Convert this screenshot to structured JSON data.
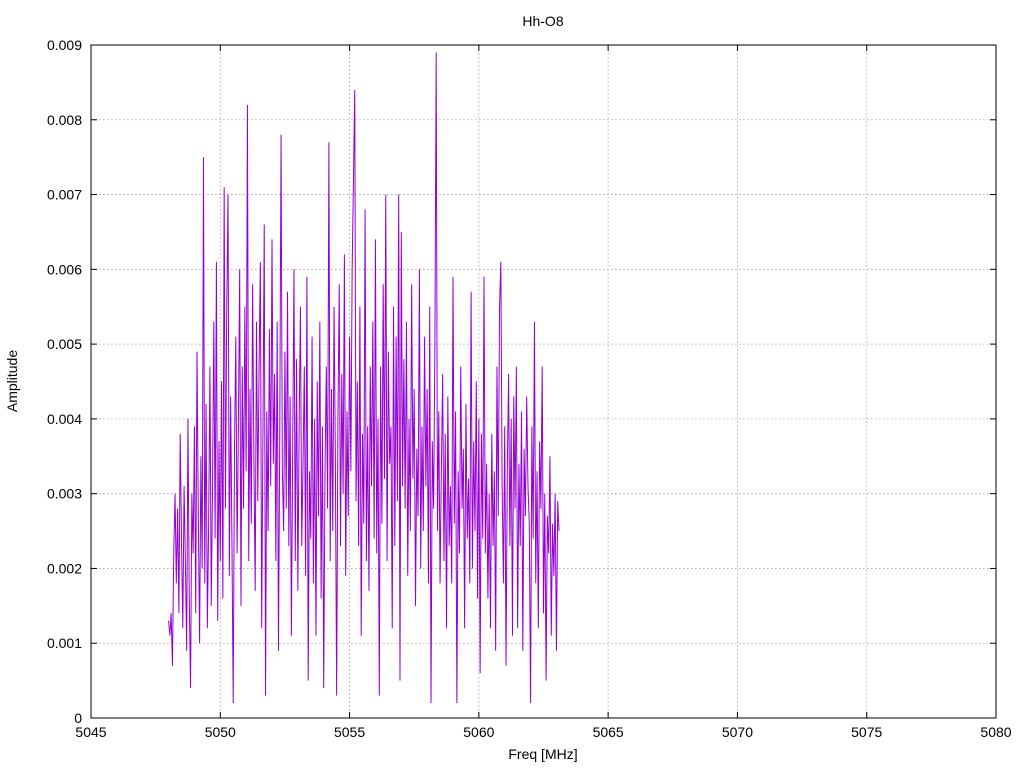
{
  "chart_data": {
    "type": "line",
    "title": "Hh-O8",
    "xlabel": "Freq [MHz]",
    "ylabel": "Amplitude",
    "xlim": [
      5045,
      5080
    ],
    "ylim": [
      0,
      0.009
    ],
    "xticks": [
      "5045",
      "5050",
      "5055",
      "5060",
      "5065",
      "5070",
      "5075",
      "5080"
    ],
    "yticks": [
      "0",
      "0.001",
      "0.002",
      "0.003",
      "0.004",
      "0.005",
      "0.006",
      "0.007",
      "0.008",
      "0.009"
    ],
    "grid": true,
    "legend": "none",
    "series": [
      {
        "color": "#9400d3",
        "x_start": 5048.0,
        "x_step": 0.05,
        "values": [
          0.0013,
          0.0011,
          0.0014,
          0.0007,
          0.0022,
          0.003,
          0.0018,
          0.0028,
          0.0014,
          0.0038,
          0.0024,
          0.0012,
          0.0031,
          0.0021,
          0.0009,
          0.004,
          0.0016,
          0.0004,
          0.003,
          0.0022,
          0.0039,
          0.0014,
          0.0049,
          0.0027,
          0.001,
          0.0035,
          0.002,
          0.0075,
          0.0018,
          0.0042,
          0.0012,
          0.0026,
          0.0047,
          0.0015,
          0.0031,
          0.0053,
          0.0024,
          0.0061,
          0.0013,
          0.0037,
          0.0021,
          0.0045,
          0.0016,
          0.0071,
          0.0028,
          0.0055,
          0.007,
          0.0019,
          0.0043,
          0.0024,
          0.0002,
          0.0036,
          0.0051,
          0.0022,
          0.0039,
          0.006,
          0.0015,
          0.0047,
          0.0028,
          0.0055,
          0.0033,
          0.0082,
          0.0021,
          0.0044,
          0.0026,
          0.0058,
          0.0035,
          0.0017,
          0.0053,
          0.0029,
          0.0047,
          0.0061,
          0.0012,
          0.0038,
          0.0066,
          0.0003,
          0.0041,
          0.0025,
          0.0052,
          0.0031,
          0.0064,
          0.0034,
          0.0046,
          0.0021,
          0.0053,
          0.0009,
          0.0038,
          0.0078,
          0.0033,
          0.0025,
          0.0049,
          0.0028,
          0.0057,
          0.0023,
          0.0043,
          0.0011,
          0.0036,
          0.006,
          0.0021,
          0.0048,
          0.0017,
          0.0039,
          0.0055,
          0.0023,
          0.0034,
          0.0047,
          0.0019,
          0.0059,
          0.0005,
          0.0033,
          0.0024,
          0.0051,
          0.0018,
          0.004,
          0.0011,
          0.0045,
          0.0027,
          0.0053,
          0.0016,
          0.0039,
          0.0004,
          0.0033,
          0.0047,
          0.0028,
          0.0077,
          0.0021,
          0.0044,
          0.0025,
          0.0055,
          0.0035,
          0.0003,
          0.004,
          0.0058,
          0.0023,
          0.0046,
          0.003,
          0.0062,
          0.0019,
          0.0041,
          0.0027,
          0.0051,
          0.0033,
          0.006,
          0.0072,
          0.0084,
          0.0029,
          0.0045,
          0.0023,
          0.0055,
          0.0011,
          0.0038,
          0.0026,
          0.0068,
          0.0021,
          0.0039,
          0.0017,
          0.0047,
          0.0031,
          0.0053,
          0.0024,
          0.0064,
          0.0022,
          0.004,
          0.0003,
          0.0047,
          0.0026,
          0.0058,
          0.0032,
          0.007,
          0.0021,
          0.0049,
          0.0034,
          0.0039,
          0.0012,
          0.0055,
          0.0023,
          0.0051,
          0.0029,
          0.007,
          0.0005,
          0.0065,
          0.0031,
          0.0048,
          0.0028,
          0.0053,
          0.0019,
          0.004,
          0.0025,
          0.0058,
          0.0032,
          0.0044,
          0.0015,
          0.0036,
          0.0027,
          0.006,
          0.002,
          0.0039,
          0.0025,
          0.0051,
          0.0031,
          0.0044,
          0.0018,
          0.0055,
          0.0002,
          0.0037,
          0.0028,
          0.005,
          0.0089,
          0.0025,
          0.0041,
          0.0018,
          0.0033,
          0.0046,
          0.0021,
          0.0038,
          0.0012,
          0.0043,
          0.0023,
          0.0031,
          0.0018,
          0.0059,
          0.0026,
          0.0041,
          0.0002,
          0.0033,
          0.0022,
          0.0047,
          0.0028,
          0.0036,
          0.0012,
          0.0042,
          0.0024,
          0.0032,
          0.0018,
          0.0057,
          0.002,
          0.0037,
          0.0025,
          0.0045,
          0.0016,
          0.004,
          0.0006,
          0.0038,
          0.0024,
          0.0059,
          0.0022,
          0.0034,
          0.0016,
          0.003,
          0.0012,
          0.0038,
          0.0023,
          0.0033,
          0.0009,
          0.0047,
          0.0027,
          0.0055,
          0.0061,
          0.0031,
          0.0018,
          0.0039,
          0.0007,
          0.0033,
          0.0046,
          0.0023,
          0.004,
          0.0011,
          0.0043,
          0.0028,
          0.0047,
          0.0012,
          0.0034,
          0.0023,
          0.0041,
          0.0009,
          0.0036,
          0.0027,
          0.0043,
          0.0031,
          0.0026,
          0.0002,
          0.0039,
          0.0024,
          0.0053,
          0.0018,
          0.0033,
          0.0012,
          0.0037,
          0.0028,
          0.0047,
          0.0014,
          0.003,
          0.0005,
          0.0027,
          0.0022,
          0.0035,
          0.0011,
          0.0026,
          0.0019,
          0.003,
          0.0009,
          0.0029,
          0.0025
        ]
      }
    ]
  }
}
